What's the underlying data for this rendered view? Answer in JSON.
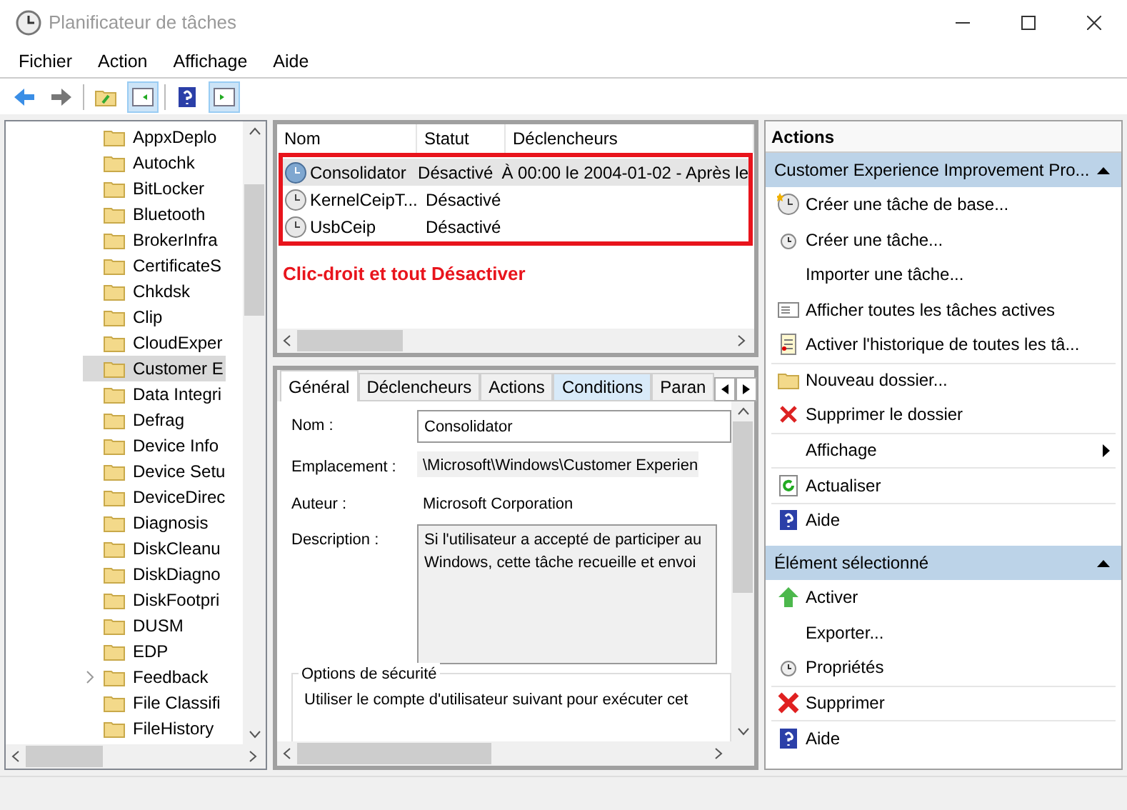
{
  "window": {
    "title": "Planificateur de tâches"
  },
  "menu": [
    "Fichier",
    "Action",
    "Affichage",
    "Aide"
  ],
  "tree": {
    "items": [
      {
        "label": "AppxDeplo",
        "selected": false,
        "expandable": false
      },
      {
        "label": "Autochk",
        "selected": false,
        "expandable": false
      },
      {
        "label": "BitLocker",
        "selected": false,
        "expandable": false
      },
      {
        "label": "Bluetooth",
        "selected": false,
        "expandable": false
      },
      {
        "label": "BrokerInfra",
        "selected": false,
        "expandable": false
      },
      {
        "label": "CertificateS",
        "selected": false,
        "expandable": false
      },
      {
        "label": "Chkdsk",
        "selected": false,
        "expandable": false
      },
      {
        "label": "Clip",
        "selected": false,
        "expandable": false
      },
      {
        "label": "CloudExper",
        "selected": false,
        "expandable": false
      },
      {
        "label": "Customer E",
        "selected": true,
        "expandable": false
      },
      {
        "label": "Data Integri",
        "selected": false,
        "expandable": false
      },
      {
        "label": "Defrag",
        "selected": false,
        "expandable": false
      },
      {
        "label": "Device Info",
        "selected": false,
        "expandable": false
      },
      {
        "label": "Device Setu",
        "selected": false,
        "expandable": false
      },
      {
        "label": "DeviceDirec",
        "selected": false,
        "expandable": false
      },
      {
        "label": "Diagnosis",
        "selected": false,
        "expandable": false
      },
      {
        "label": "DiskCleanu",
        "selected": false,
        "expandable": false
      },
      {
        "label": "DiskDiagno",
        "selected": false,
        "expandable": false
      },
      {
        "label": "DiskFootpri",
        "selected": false,
        "expandable": false
      },
      {
        "label": "DUSM",
        "selected": false,
        "expandable": false
      },
      {
        "label": "EDP",
        "selected": false,
        "expandable": false
      },
      {
        "label": "Feedback",
        "selected": false,
        "expandable": true
      },
      {
        "label": "File Classifi",
        "selected": false,
        "expandable": false
      },
      {
        "label": "FileHistory",
        "selected": false,
        "expandable": false
      }
    ]
  },
  "task_list": {
    "columns": [
      "Nom",
      "Statut",
      "Déclencheurs"
    ],
    "rows": [
      {
        "name": "Consolidator",
        "status": "Désactivé",
        "triggers": "À 00:00 le 2004-01-02 - Après le",
        "selected": true
      },
      {
        "name": "KernelCeipT...",
        "status": "Désactivé",
        "selected": false
      },
      {
        "name": "UsbCeip",
        "status": "Désactivé",
        "selected": false
      }
    ],
    "annotation": "Clic-droit et tout Désactiver"
  },
  "details": {
    "tabs": [
      {
        "label": "Général",
        "selected": true,
        "hovered": false
      },
      {
        "label": "Déclencheurs",
        "selected": false,
        "hovered": false
      },
      {
        "label": "Actions",
        "selected": false,
        "hovered": false
      },
      {
        "label": "Conditions",
        "selected": false,
        "hovered": true
      },
      {
        "label": "Paran",
        "selected": false,
        "hovered": false
      }
    ],
    "fields": [
      {
        "label": "Nom :",
        "value": "Consolidator",
        "kind": "input"
      },
      {
        "label": "Emplacement :",
        "value": "\\Microsoft\\Windows\\Customer Experien",
        "kind": "readonly"
      },
      {
        "label": "Auteur :",
        "value": "Microsoft Corporation",
        "kind": "plain"
      },
      {
        "label": "Description :",
        "value": "Si l'utilisateur a accepté de participer au\nWindows, cette tâche recueille et envoi",
        "kind": "textarea"
      }
    ],
    "security": {
      "title": "Options de sécurité",
      "text": "Utiliser le compte d'utilisateur suivant pour exécuter cet"
    }
  },
  "actions": {
    "title": "Actions",
    "sections": [
      {
        "title": "Customer Experience Improvement Pro...",
        "expanded": true,
        "items": [
          {
            "label": "Créer une tâche de base...",
            "kind": "clock-star",
            "divider": false
          },
          {
            "label": "Créer une tâche...",
            "kind": "clock-small",
            "divider": false
          },
          {
            "label": "Importer une tâche...",
            "kind": "none",
            "divider": false
          },
          {
            "label": "Afficher toutes les tâches actives",
            "kind": "list",
            "divider": false
          },
          {
            "label": "Activer l'historique de toutes les tâ...",
            "kind": "log",
            "divider": false
          },
          {
            "label": "Nouveau dossier...",
            "kind": "folder",
            "divider": true
          },
          {
            "label": "Supprimer le dossier",
            "kind": "delete",
            "divider": false
          },
          {
            "label": "Affichage",
            "kind": "submenu",
            "divider": true
          },
          {
            "label": "Actualiser",
            "kind": "refresh",
            "divider": true
          },
          {
            "label": "Aide",
            "kind": "help",
            "divider": true
          }
        ]
      },
      {
        "title": "Élément sélectionné",
        "expanded": true,
        "items": [
          {
            "label": "Activer",
            "kind": "up",
            "divider": false
          },
          {
            "label": "Exporter...",
            "kind": "none",
            "divider": false
          },
          {
            "label": "Propriétés",
            "kind": "clock-small",
            "divider": false
          },
          {
            "label": "Supprimer",
            "kind": "delete-big",
            "divider": true
          },
          {
            "label": "Aide",
            "kind": "help",
            "divider": true
          }
        ]
      }
    ]
  }
}
